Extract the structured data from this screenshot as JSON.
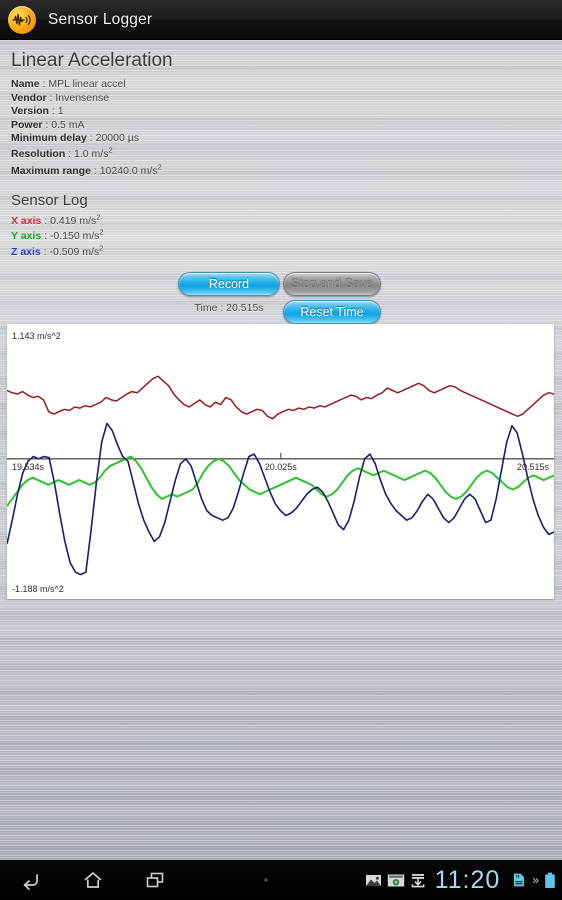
{
  "titlebar": {
    "app_name": "Sensor Logger",
    "icon": "waveform-app-icon"
  },
  "sensor": {
    "title": "Linear Acceleration",
    "fields": [
      {
        "label": "Name",
        "value": "MPL linear accel"
      },
      {
        "label": "Vendor",
        "value": "Invensense"
      },
      {
        "label": "Version",
        "value": "1"
      },
      {
        "label": "Power",
        "value": "0.5 mA"
      },
      {
        "label": "Minimum delay",
        "value": "20000 µs"
      },
      {
        "label": "Resolution",
        "value": "1.0 m/s",
        "sup": "2"
      },
      {
        "label": "Maximum range",
        "value": "10240.0 m/s",
        "sup": "2"
      }
    ]
  },
  "sensor_log": {
    "title": "Sensor Log",
    "axes": [
      {
        "label": "X axis",
        "value": "0.419 m/s",
        "sup": "2",
        "color": "#d8252b"
      },
      {
        "label": "Y axis",
        "value": "-0.150 m/s",
        "sup": "2",
        "color": "#18a31b"
      },
      {
        "label": "Z axis",
        "value": "-0.509 m/s",
        "sup": "2",
        "color": "#2a36c9"
      }
    ]
  },
  "controls": {
    "record_label": "Record",
    "stop_save_label": "Stop and Save",
    "reset_time_label": "Reset Time",
    "time_label": "Time : 20.515s",
    "stop_save_enabled": false
  },
  "chart_data": {
    "type": "line",
    "title": "",
    "xlabel": "",
    "ylabel": "",
    "top_label": "1.143 m/s^2",
    "bottom_label": "-1.188 m/s^2",
    "ylim": [
      -1.188,
      1.143
    ],
    "grid": false,
    "zero_line": true,
    "legend_position": "none",
    "x_tick_labels": [
      "19.534s",
      "20.025s",
      "20.515s"
    ],
    "x_tick_values": [
      19.534,
      20.025,
      20.515
    ],
    "xlim": [
      19.534,
      20.515
    ],
    "series": [
      {
        "name": "X axis",
        "color": "#9b1b1b",
        "values": [
          0.58,
          0.56,
          0.55,
          0.57,
          0.54,
          0.52,
          0.53,
          0.5,
          0.4,
          0.38,
          0.4,
          0.42,
          0.41,
          0.44,
          0.43,
          0.45,
          0.44,
          0.46,
          0.48,
          0.52,
          0.5,
          0.49,
          0.52,
          0.55,
          0.57,
          0.56,
          0.6,
          0.64,
          0.68,
          0.7,
          0.66,
          0.62,
          0.55,
          0.5,
          0.46,
          0.44,
          0.47,
          0.5,
          0.46,
          0.44,
          0.48,
          0.46,
          0.52,
          0.5,
          0.44,
          0.4,
          0.38,
          0.4,
          0.42,
          0.41,
          0.36,
          0.34,
          0.38,
          0.4,
          0.42,
          0.41,
          0.43,
          0.42,
          0.44,
          0.43,
          0.45,
          0.44,
          0.46,
          0.48,
          0.5,
          0.52,
          0.54,
          0.53,
          0.5,
          0.52,
          0.51,
          0.54,
          0.56,
          0.6,
          0.58,
          0.56,
          0.58,
          0.6,
          0.62,
          0.64,
          0.62,
          0.58,
          0.56,
          0.58,
          0.6,
          0.62,
          0.61,
          0.58,
          0.56,
          0.54,
          0.52,
          0.5,
          0.48,
          0.46,
          0.44,
          0.42,
          0.4,
          0.38,
          0.36,
          0.38,
          0.42,
          0.46,
          0.5,
          0.54,
          0.56,
          0.55
        ]
      },
      {
        "name": "Y axis",
        "color": "#2cc42c",
        "values": [
          -0.4,
          -0.34,
          -0.28,
          -0.22,
          -0.18,
          -0.16,
          -0.18,
          -0.2,
          -0.22,
          -0.2,
          -0.18,
          -0.2,
          -0.22,
          -0.2,
          -0.18,
          -0.2,
          -0.22,
          -0.2,
          -0.16,
          -0.1,
          -0.06,
          -0.04,
          -0.02,
          0.0,
          0.02,
          -0.02,
          -0.08,
          -0.16,
          -0.24,
          -0.3,
          -0.34,
          -0.32,
          -0.3,
          -0.32,
          -0.3,
          -0.28,
          -0.26,
          -0.2,
          -0.12,
          -0.06,
          -0.02,
          0.0,
          -0.02,
          -0.06,
          -0.12,
          -0.18,
          -0.22,
          -0.26,
          -0.28,
          -0.3,
          -0.28,
          -0.26,
          -0.24,
          -0.22,
          -0.2,
          -0.18,
          -0.16,
          -0.18,
          -0.2,
          -0.22,
          -0.26,
          -0.3,
          -0.32,
          -0.3,
          -0.26,
          -0.2,
          -0.14,
          -0.1,
          -0.08,
          -0.1,
          -0.12,
          -0.14,
          -0.12,
          -0.1,
          -0.12,
          -0.14,
          -0.16,
          -0.18,
          -0.16,
          -0.14,
          -0.12,
          -0.1,
          -0.12,
          -0.16,
          -0.22,
          -0.28,
          -0.32,
          -0.34,
          -0.32,
          -0.28,
          -0.22,
          -0.16,
          -0.12,
          -0.1,
          -0.12,
          -0.16,
          -0.2,
          -0.24,
          -0.26,
          -0.24,
          -0.2,
          -0.16,
          -0.14,
          -0.16,
          -0.18,
          -0.16,
          -0.14
        ]
      },
      {
        "name": "Z axis",
        "color": "#16206e",
        "values": [
          -0.72,
          -0.52,
          -0.3,
          -0.12,
          -0.02,
          0.02,
          0.0,
          0.02,
          0.01,
          -0.2,
          -0.46,
          -0.7,
          -0.88,
          -0.96,
          -0.98,
          -0.96,
          -0.6,
          -0.2,
          0.14,
          0.3,
          0.24,
          0.12,
          0.02,
          -0.02,
          -0.2,
          -0.38,
          -0.52,
          -0.62,
          -0.7,
          -0.66,
          -0.54,
          -0.36,
          -0.18,
          -0.04,
          0.0,
          -0.06,
          -0.2,
          -0.34,
          -0.44,
          -0.48,
          -0.5,
          -0.52,
          -0.5,
          -0.42,
          -0.28,
          -0.12,
          0.02,
          0.04,
          -0.04,
          -0.16,
          -0.28,
          -0.38,
          -0.44,
          -0.48,
          -0.46,
          -0.42,
          -0.36,
          -0.3,
          -0.26,
          -0.24,
          -0.28,
          -0.36,
          -0.46,
          -0.56,
          -0.6,
          -0.52,
          -0.36,
          -0.16,
          0.0,
          0.04,
          -0.04,
          -0.18,
          -0.3,
          -0.38,
          -0.44,
          -0.48,
          -0.52,
          -0.5,
          -0.44,
          -0.36,
          -0.3,
          -0.34,
          -0.42,
          -0.5,
          -0.54,
          -0.5,
          -0.42,
          -0.34,
          -0.3,
          -0.34,
          -0.44,
          -0.54,
          -0.52,
          -0.34,
          -0.1,
          0.14,
          0.28,
          0.22,
          0.04,
          -0.16,
          -0.34,
          -0.48,
          -0.58,
          -0.64,
          -0.62
        ]
      }
    ]
  },
  "navbar": {
    "back_icon": "back-arrow-icon",
    "home_icon": "home-icon",
    "recents_icon": "recent-apps-icon",
    "clock": "11:20",
    "status_icons": [
      "image-icon",
      "screenshot-icon",
      "download-icon",
      "sd-card-icon",
      "battery-icon"
    ],
    "chevron": "»"
  }
}
